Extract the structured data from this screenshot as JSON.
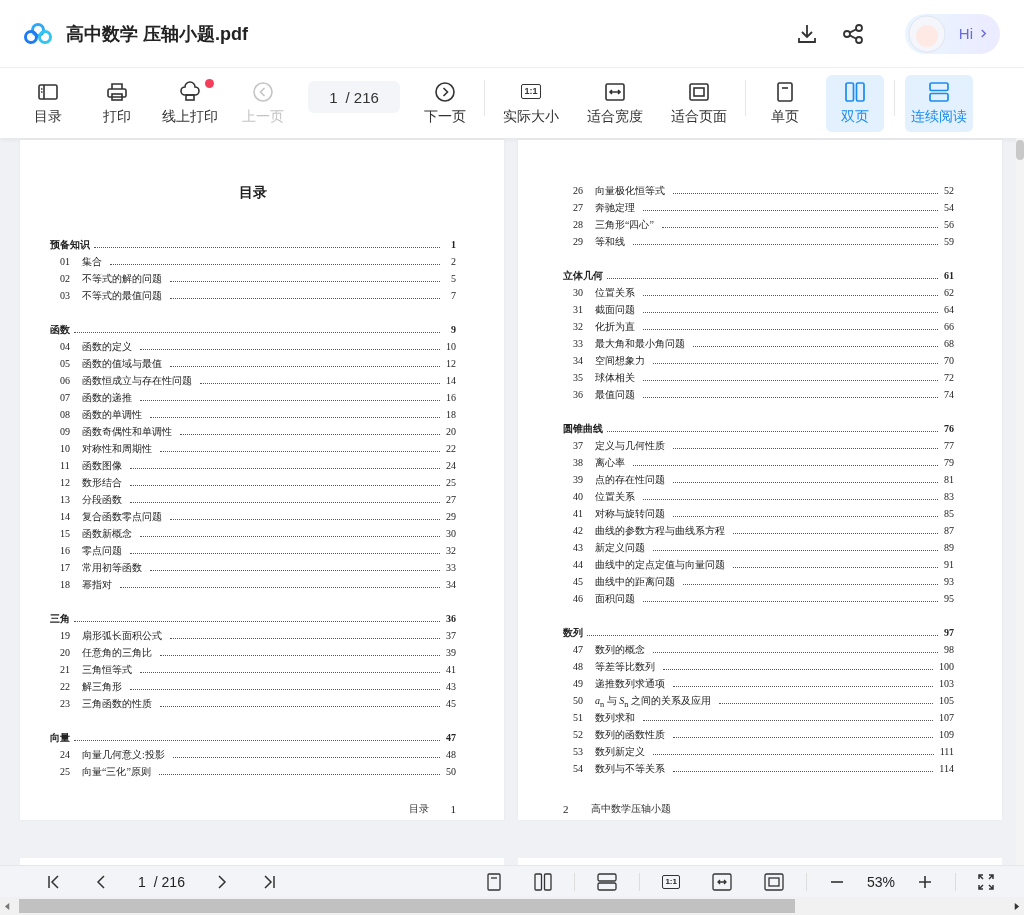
{
  "header": {
    "title": "高中数学 压轴小题.pdf",
    "greeting": "Hi"
  },
  "toolbar": {
    "groups": [
      [
        {
          "kind": "toc",
          "label": "目录",
          "disabled": false,
          "badge": false
        },
        {
          "kind": "print",
          "label": "打印",
          "disabled": false,
          "badge": false
        },
        {
          "kind": "cloud_print",
          "label": "线上打印",
          "disabled": false,
          "badge": true
        },
        {
          "kind": "prev",
          "label": "上一页",
          "disabled": true,
          "badge": false
        },
        {
          "kind": "page_field",
          "value": "1",
          "total": "/ 216"
        },
        {
          "kind": "next",
          "label": "下一页",
          "disabled": false,
          "badge": false
        }
      ],
      [
        {
          "kind": "actual_size",
          "label": "实际大小",
          "icon_text": "1:1"
        },
        {
          "kind": "fit_width",
          "label": "适合宽度"
        },
        {
          "kind": "fit_page",
          "label": "适合页面"
        }
      ],
      [
        {
          "kind": "single",
          "label": "单页",
          "selected": false
        },
        {
          "kind": "double",
          "label": "双页",
          "selected": true
        }
      ],
      [
        {
          "kind": "continuous",
          "label": "连续阅读",
          "selected": true
        }
      ]
    ]
  },
  "pages": [
    {
      "heading": "目录",
      "footer": [
        {
          "kind": "label",
          "text": "目录"
        },
        {
          "kind": "number",
          "text": "1"
        }
      ],
      "entries": [
        {
          "kind": "section",
          "title": "预备知识",
          "page": "1"
        },
        {
          "kind": "item",
          "num": "01",
          "title": "集合",
          "page": "2"
        },
        {
          "kind": "item",
          "num": "02",
          "title": "不等式的解的问题",
          "page": "5"
        },
        {
          "kind": "item",
          "num": "03",
          "title": "不等式的最值问题",
          "page": "7"
        },
        {
          "kind": "section",
          "title": "函数",
          "page": "9"
        },
        {
          "kind": "item",
          "num": "04",
          "title": "函数的定义",
          "page": "10"
        },
        {
          "kind": "item",
          "num": "05",
          "title": "函数的值域与最值",
          "page": "12"
        },
        {
          "kind": "item",
          "num": "06",
          "title": "函数恒成立与存在性问题",
          "page": "14"
        },
        {
          "kind": "item",
          "num": "07",
          "title": "函数的递推",
          "page": "16"
        },
        {
          "kind": "item",
          "num": "08",
          "title": "函数的单调性",
          "page": "18"
        },
        {
          "kind": "item",
          "num": "09",
          "title": "函数奇偶性和单调性",
          "page": "20"
        },
        {
          "kind": "item",
          "num": "10",
          "title": "对称性和周期性",
          "page": "22"
        },
        {
          "kind": "item",
          "num": "11",
          "title": "函数图像",
          "page": "24"
        },
        {
          "kind": "item",
          "num": "12",
          "title": "数形结合",
          "page": "25"
        },
        {
          "kind": "item",
          "num": "13",
          "title": "分段函数",
          "page": "27"
        },
        {
          "kind": "item",
          "num": "14",
          "title": "复合函数零点问题",
          "page": "29"
        },
        {
          "kind": "item",
          "num": "15",
          "title": "函数新概念",
          "page": "30"
        },
        {
          "kind": "item",
          "num": "16",
          "title": "零点问题",
          "page": "32"
        },
        {
          "kind": "item",
          "num": "17",
          "title": "常用初等函数",
          "page": "33"
        },
        {
          "kind": "item",
          "num": "18",
          "title": "幂指对",
          "page": "34"
        },
        {
          "kind": "section",
          "title": "三角",
          "page": "36"
        },
        {
          "kind": "item",
          "num": "19",
          "title": "扇形弧长面积公式",
          "page": "37"
        },
        {
          "kind": "item",
          "num": "20",
          "title": "任意角的三角比",
          "page": "39"
        },
        {
          "kind": "item",
          "num": "21",
          "title": "三角恒等式",
          "page": "41"
        },
        {
          "kind": "item",
          "num": "22",
          "title": "解三角形",
          "page": "43"
        },
        {
          "kind": "item",
          "num": "23",
          "title": "三角函数的性质",
          "page": "45"
        },
        {
          "kind": "section",
          "title": "向量",
          "page": "47"
        },
        {
          "kind": "item",
          "num": "24",
          "title": "向量几何意义:投影",
          "page": "48"
        },
        {
          "kind": "item",
          "num": "25",
          "title": "向量“三化”原则",
          "page": "50"
        }
      ]
    },
    {
      "footer": [
        {
          "kind": "number",
          "text": "2"
        },
        {
          "kind": "label",
          "text": "高中数学压轴小题"
        }
      ],
      "entries": [
        {
          "kind": "item",
          "num": "26",
          "title": "向量极化恒等式",
          "page": "52"
        },
        {
          "kind": "item",
          "num": "27",
          "title": "奔驰定理",
          "page": "54"
        },
        {
          "kind": "item",
          "num": "28",
          "title": "三角形“四心”",
          "page": "56"
        },
        {
          "kind": "item",
          "num": "29",
          "title": "等和线",
          "page": "59"
        },
        {
          "kind": "section",
          "title": "立体几何",
          "page": "61"
        },
        {
          "kind": "item",
          "num": "30",
          "title": "位置关系",
          "page": "62"
        },
        {
          "kind": "item",
          "num": "31",
          "title": "截面问题",
          "page": "64"
        },
        {
          "kind": "item",
          "num": "32",
          "title": "化折为直",
          "page": "66"
        },
        {
          "kind": "item",
          "num": "33",
          "title": "最大角和最小角问题",
          "page": "68"
        },
        {
          "kind": "item",
          "num": "34",
          "title": "空间想象力",
          "page": "70"
        },
        {
          "kind": "item",
          "num": "35",
          "title": "球体相关",
          "page": "72"
        },
        {
          "kind": "item",
          "num": "36",
          "title": "最值问题",
          "page": "74"
        },
        {
          "kind": "section",
          "title": "圆锥曲线",
          "page": "76"
        },
        {
          "kind": "item",
          "num": "37",
          "title": "定义与几何性质",
          "page": "77"
        },
        {
          "kind": "item",
          "num": "38",
          "title": "离心率",
          "page": "79"
        },
        {
          "kind": "item",
          "num": "39",
          "title": "点的存在性问题",
          "page": "81"
        },
        {
          "kind": "item",
          "num": "40",
          "title": "位置关系",
          "page": "83"
        },
        {
          "kind": "item",
          "num": "41",
          "title": "对称与旋转问题",
          "page": "85"
        },
        {
          "kind": "item",
          "num": "42",
          "title": "曲线的参数方程与曲线系方程",
          "page": "87"
        },
        {
          "kind": "item",
          "num": "43",
          "title": "新定义问题",
          "page": "89"
        },
        {
          "kind": "item",
          "num": "44",
          "title": "曲线中的定点定值与向量问题",
          "page": "91"
        },
        {
          "kind": "item",
          "num": "45",
          "title": "曲线中的距离问题",
          "page": "93"
        },
        {
          "kind": "item",
          "num": "46",
          "title": "面积问题",
          "page": "95"
        },
        {
          "kind": "section",
          "title": "数列",
          "page": "97"
        },
        {
          "kind": "item",
          "num": "47",
          "title": "数列的概念",
          "page": "98"
        },
        {
          "kind": "item",
          "num": "48",
          "title": "等差等比数列",
          "page": "100"
        },
        {
          "kind": "item",
          "num": "49",
          "title": "递推数列求通项",
          "page": "103"
        },
        {
          "kind": "item",
          "num": "50",
          "title": "*a*$_{n}$ 与 *S*$_{n}$ 之间的关系及应用",
          "page": "105"
        },
        {
          "kind": "item",
          "num": "51",
          "title": "数列求和",
          "page": "107"
        },
        {
          "kind": "item",
          "num": "52",
          "title": "数列的函数性质",
          "page": "109"
        },
        {
          "kind": "item",
          "num": "53",
          "title": "数列新定义",
          "page": "111"
        },
        {
          "kind": "item",
          "num": "54",
          "title": "数列与不等关系",
          "page": "114"
        }
      ]
    }
  ],
  "bottom_bar": {
    "page_value": "1",
    "page_total": "/ 216",
    "zoom": "53%",
    "actual_size_text": "1:1"
  }
}
